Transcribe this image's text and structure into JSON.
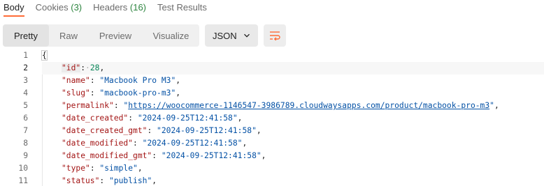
{
  "tabs": [
    {
      "label": "Body",
      "count": ""
    },
    {
      "label": "Cookies",
      "count": "(3)"
    },
    {
      "label": "Headers",
      "count": "(16)"
    },
    {
      "label": "Test Results",
      "count": ""
    }
  ],
  "toolbar": {
    "views": [
      "Pretty",
      "Raw",
      "Preview",
      "Visualize"
    ],
    "active_view": "Pretty",
    "format": "JSON",
    "wrap_icon": "wrap-lines-icon",
    "chevron_icon": "chevron-down-icon"
  },
  "colors": {
    "active_tab_underline": "#ff6c37",
    "count": "#2e8540",
    "json_key": "#a31515",
    "json_string": "#0451a5",
    "json_number": "#098658"
  },
  "editor": {
    "line_numbers": [
      "1",
      "2",
      "3",
      "4",
      "5",
      "6",
      "7",
      "8",
      "9",
      "10",
      "11"
    ],
    "current_line": "2",
    "open_brace": "{",
    "fields": [
      {
        "key": "\"id\"",
        "value": "28",
        "type": "number"
      },
      {
        "key": "\"name\"",
        "value": "\"Macbook Pro M3\"",
        "type": "string"
      },
      {
        "key": "\"slug\"",
        "value": "\"macbook-pro-m3\"",
        "type": "string"
      },
      {
        "key": "\"permalink\"",
        "value": "https://woocommerce-1146547-3986789.cloudwaysapps.com/product/macbook-pro-m3",
        "type": "link"
      },
      {
        "key": "\"date_created\"",
        "value": "\"2024-09-25T12:41:58\"",
        "type": "string"
      },
      {
        "key": "\"date_created_gmt\"",
        "value": "\"2024-09-25T12:41:58\"",
        "type": "string"
      },
      {
        "key": "\"date_modified\"",
        "value": "\"2024-09-25T12:41:58\"",
        "type": "string"
      },
      {
        "key": "\"date_modified_gmt\"",
        "value": "\"2024-09-25T12:41:58\"",
        "type": "string"
      },
      {
        "key": "\"type\"",
        "value": "\"simple\"",
        "type": "string"
      },
      {
        "key": "\"status\"",
        "value": "\"publish\"",
        "type": "string"
      }
    ]
  }
}
